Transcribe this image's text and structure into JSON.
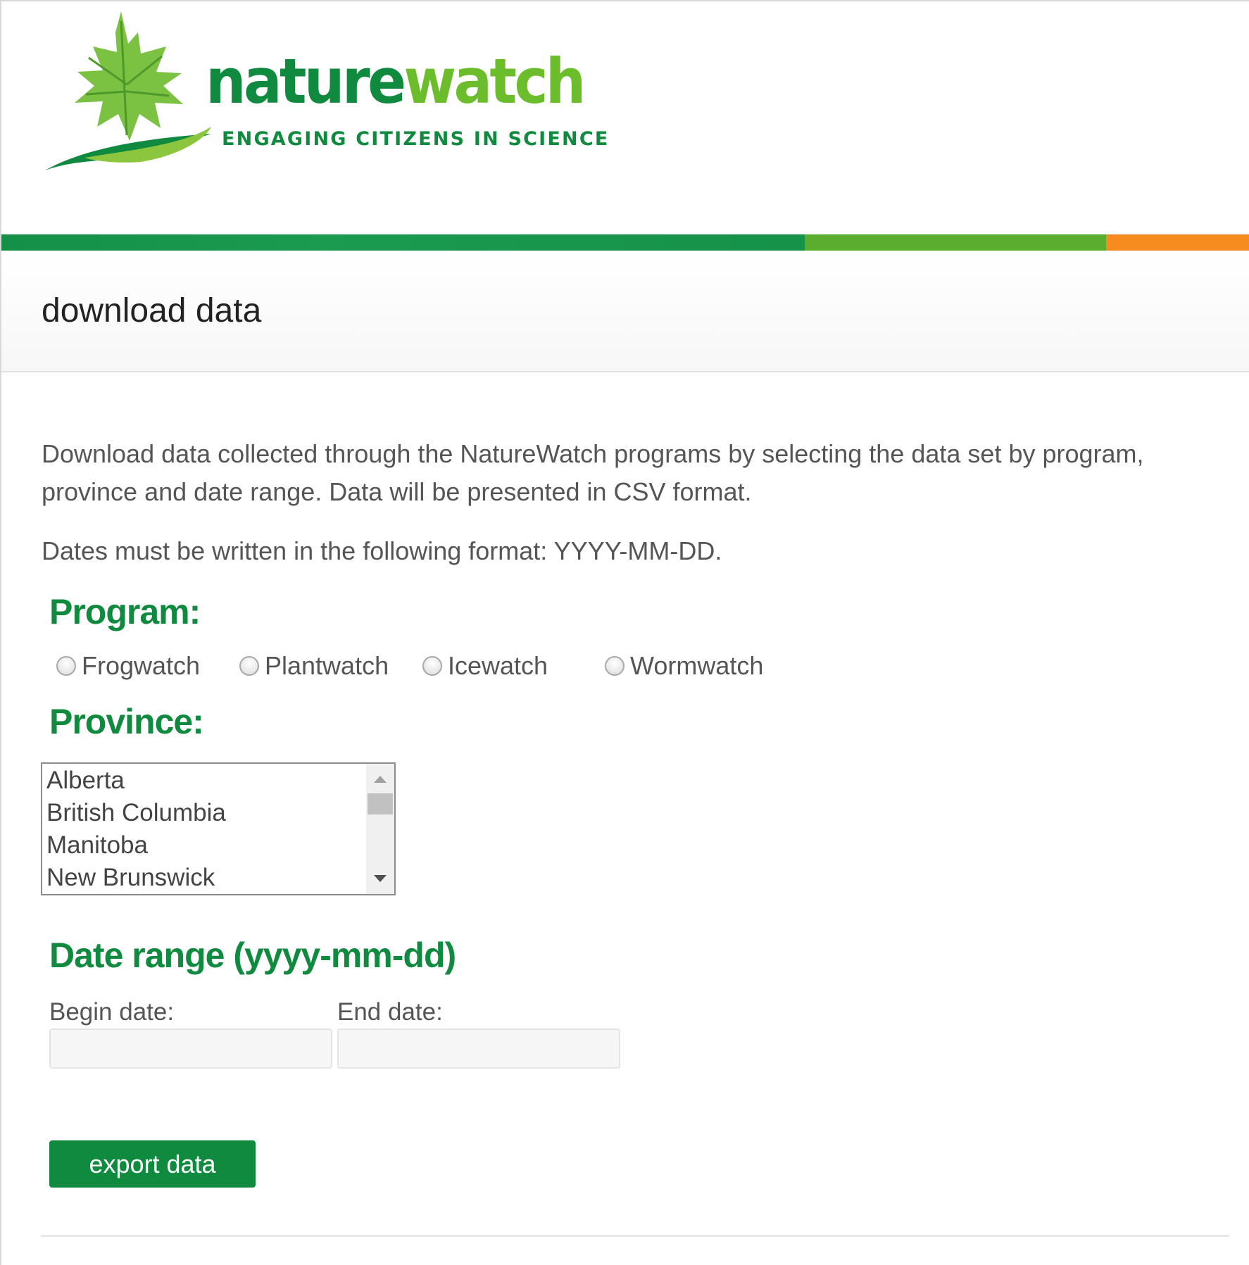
{
  "header": {
    "wordmark_part1": "nature",
    "wordmark_part2": "watch",
    "tagline": "ENGAGING CITIZENS IN SCIENCE",
    "logo_icon": "maple-leaf-icon",
    "band_colors": [
      "#159049",
      "#5aae2e",
      "#f68b1f"
    ]
  },
  "page": {
    "title": "download data",
    "intro": "Download data collected through the NatureWatch programs by selecting the data set by program, province and date range. Data will be presented in CSV format.",
    "format_note": "Dates must be written in the following format: YYYY-MM-DD."
  },
  "program": {
    "heading": "Program:",
    "options": [
      "Frogwatch",
      "Plantwatch",
      "Icewatch",
      "Wormwatch"
    ],
    "selected": null
  },
  "province": {
    "heading": "Province:",
    "visible_options": [
      "Alberta",
      "British Columbia",
      "Manitoba",
      "New Brunswick"
    ]
  },
  "date_range": {
    "heading": "Date range (yyyy-mm-dd)",
    "begin_label": "Begin date:",
    "begin_value": "",
    "end_label": "End date:",
    "end_value": ""
  },
  "actions": {
    "export_label": "export data"
  },
  "colors": {
    "accent": "#0f8a3e",
    "leaf_light": "#6bbd2c",
    "orange": "#f68b1f"
  }
}
